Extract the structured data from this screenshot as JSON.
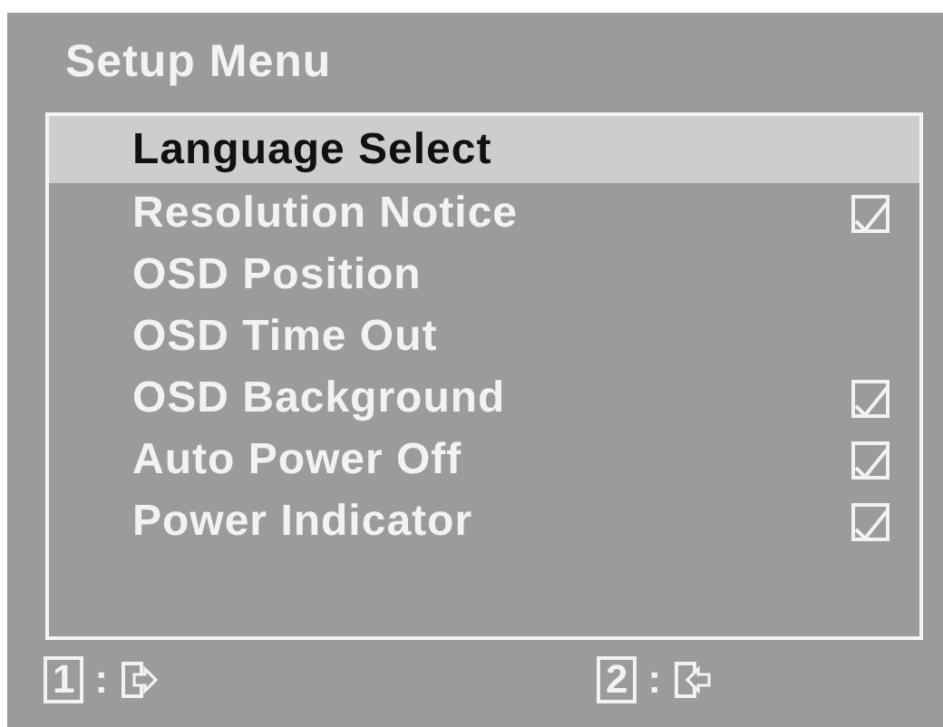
{
  "title": "Setup Menu",
  "items": [
    {
      "label": "Language Select",
      "kind": "submenu",
      "selected": true
    },
    {
      "label": "Resolution Notice",
      "kind": "checkbox",
      "checked": true,
      "selected": false
    },
    {
      "label": "OSD Position",
      "kind": "submenu",
      "selected": false
    },
    {
      "label": "OSD Time Out",
      "kind": "submenu",
      "selected": false
    },
    {
      "label": "OSD Background",
      "kind": "checkbox",
      "checked": true,
      "selected": false
    },
    {
      "label": "Auto Power Off",
      "kind": "checkbox",
      "checked": true,
      "selected": false
    },
    {
      "label": "Power Indicator",
      "kind": "checkbox",
      "checked": true,
      "selected": false
    }
  ],
  "footer": [
    {
      "key": "1",
      "separator": ":",
      "kind": "exit"
    },
    {
      "key": "2",
      "separator": ":",
      "kind": "enter"
    }
  ]
}
